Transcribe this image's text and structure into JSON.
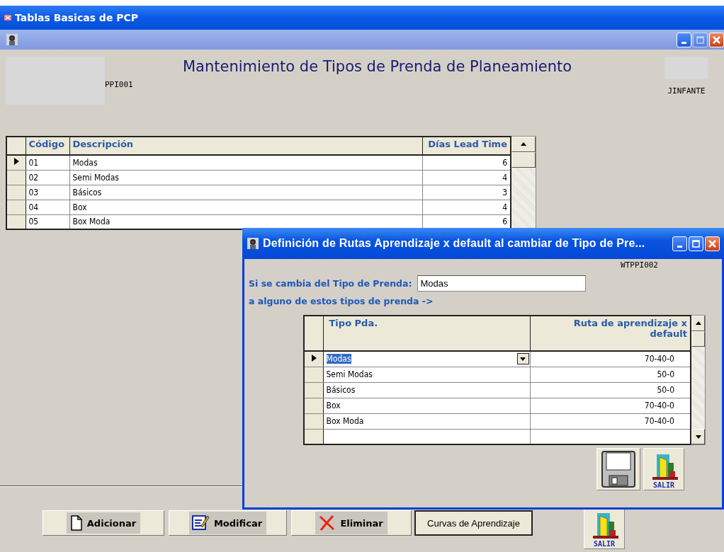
{
  "app": {
    "title": "Tablas Basicas de PCP"
  },
  "window": {
    "maximize_disabled": true,
    "heading": "Mantenimiento de Tipos de Prenda de Planeamiento",
    "form_code": "PPI001",
    "user": "JINFANTE"
  },
  "table": {
    "columns": [
      {
        "label": "Código"
      },
      {
        "label": "Descripción"
      },
      {
        "label": "Días Lead Time"
      }
    ],
    "rows": [
      {
        "cells": [
          "01",
          "Modas",
          "6"
        ],
        "selected": true
      },
      {
        "cells": [
          "02",
          "Semi Modas",
          "4"
        ],
        "selected": false
      },
      {
        "cells": [
          "03",
          "Básicos",
          "3"
        ],
        "selected": false
      },
      {
        "cells": [
          "04",
          "Box",
          "4"
        ],
        "selected": false
      },
      {
        "cells": [
          "05",
          "Box Moda",
          "6"
        ],
        "selected": false
      }
    ]
  },
  "buttons": [
    {
      "kind": "add",
      "label": "Adicionar"
    },
    {
      "kind": "edit",
      "label": "Modificar"
    },
    {
      "kind": "delete",
      "label": "Eliminar"
    },
    {
      "kind": "plain",
      "label": "Curvas de Aprendizaje"
    },
    {
      "kind": "exit",
      "label": "SALIR"
    }
  ],
  "dialog": {
    "title": "Definición de Rutas Aprendizaje x default al cambiar de Tipo de Pre...",
    "maximize_disabled": false,
    "form_code": "WTPPI002",
    "field_label": "Si se cambia del Tipo de Prenda:",
    "field_value": "Modas",
    "note": "a alguno de estos tipos de prenda ->",
    "table": {
      "columns": [
        {
          "label": "Tipo Pda."
        },
        {
          "label": "Ruta de aprendizaje x default"
        }
      ],
      "rows": [
        {
          "cells": [
            "Modas",
            "70-40-0"
          ],
          "selected": true
        },
        {
          "cells": [
            "Semi Modas",
            "50-0"
          ],
          "selected": false
        },
        {
          "cells": [
            "Básicos",
            "50-0"
          ],
          "selected": false
        },
        {
          "cells": [
            "Box",
            "70-40-0"
          ],
          "selected": false
        },
        {
          "cells": [
            "Box Moda",
            "70-40-0"
          ],
          "selected": false
        }
      ]
    },
    "buttons": [
      {
        "kind": "save"
      },
      {
        "kind": "exit",
        "label": "SALIR"
      }
    ]
  }
}
